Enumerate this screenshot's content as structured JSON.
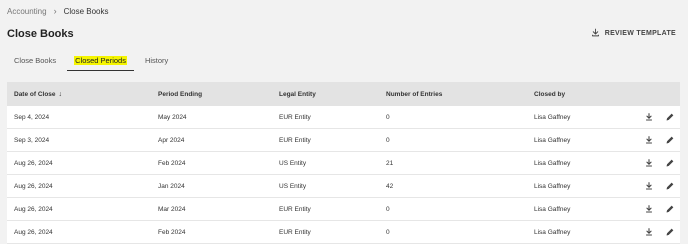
{
  "breadcrumb": {
    "parent": "Accounting",
    "separator": "›",
    "current": "Close Books"
  },
  "page_title": "Close Books",
  "review_template_label": "REVIEW TEMPLATE",
  "tabs": [
    {
      "label": "Close Books",
      "active": false
    },
    {
      "label": "Closed Periods",
      "active": true
    },
    {
      "label": "History",
      "active": false
    }
  ],
  "table": {
    "headers": {
      "date": "Date of Close",
      "sort_indicator": "↓",
      "period": "Period Ending",
      "entity": "Legal Entity",
      "entries": "Number of Entries",
      "closed_by": "Closed by"
    },
    "rows": [
      {
        "date": "Sep 4, 2024",
        "period": "May 2024",
        "entity": "EUR Entity",
        "entries": "0",
        "closed_by": "Lisa Gaffney"
      },
      {
        "date": "Sep 3, 2024",
        "period": "Apr 2024",
        "entity": "EUR Entity",
        "entries": "0",
        "closed_by": "Lisa Gaffney"
      },
      {
        "date": "Aug 26, 2024",
        "period": "Feb 2024",
        "entity": "US Entity",
        "entries": "21",
        "closed_by": "Lisa Gaffney"
      },
      {
        "date": "Aug 26, 2024",
        "period": "Jan 2024",
        "entity": "US Entity",
        "entries": "42",
        "closed_by": "Lisa Gaffney"
      },
      {
        "date": "Aug 26, 2024",
        "period": "Mar 2024",
        "entity": "EUR Entity",
        "entries": "0",
        "closed_by": "Lisa Gaffney"
      },
      {
        "date": "Aug 26, 2024",
        "period": "Feb 2024",
        "entity": "EUR Entity",
        "entries": "0",
        "closed_by": "Lisa Gaffney"
      }
    ]
  },
  "colors": {
    "tab_highlight": "#f5f500",
    "header_bg": "#e3e3e3",
    "page_bg": "#f2f2f2"
  }
}
